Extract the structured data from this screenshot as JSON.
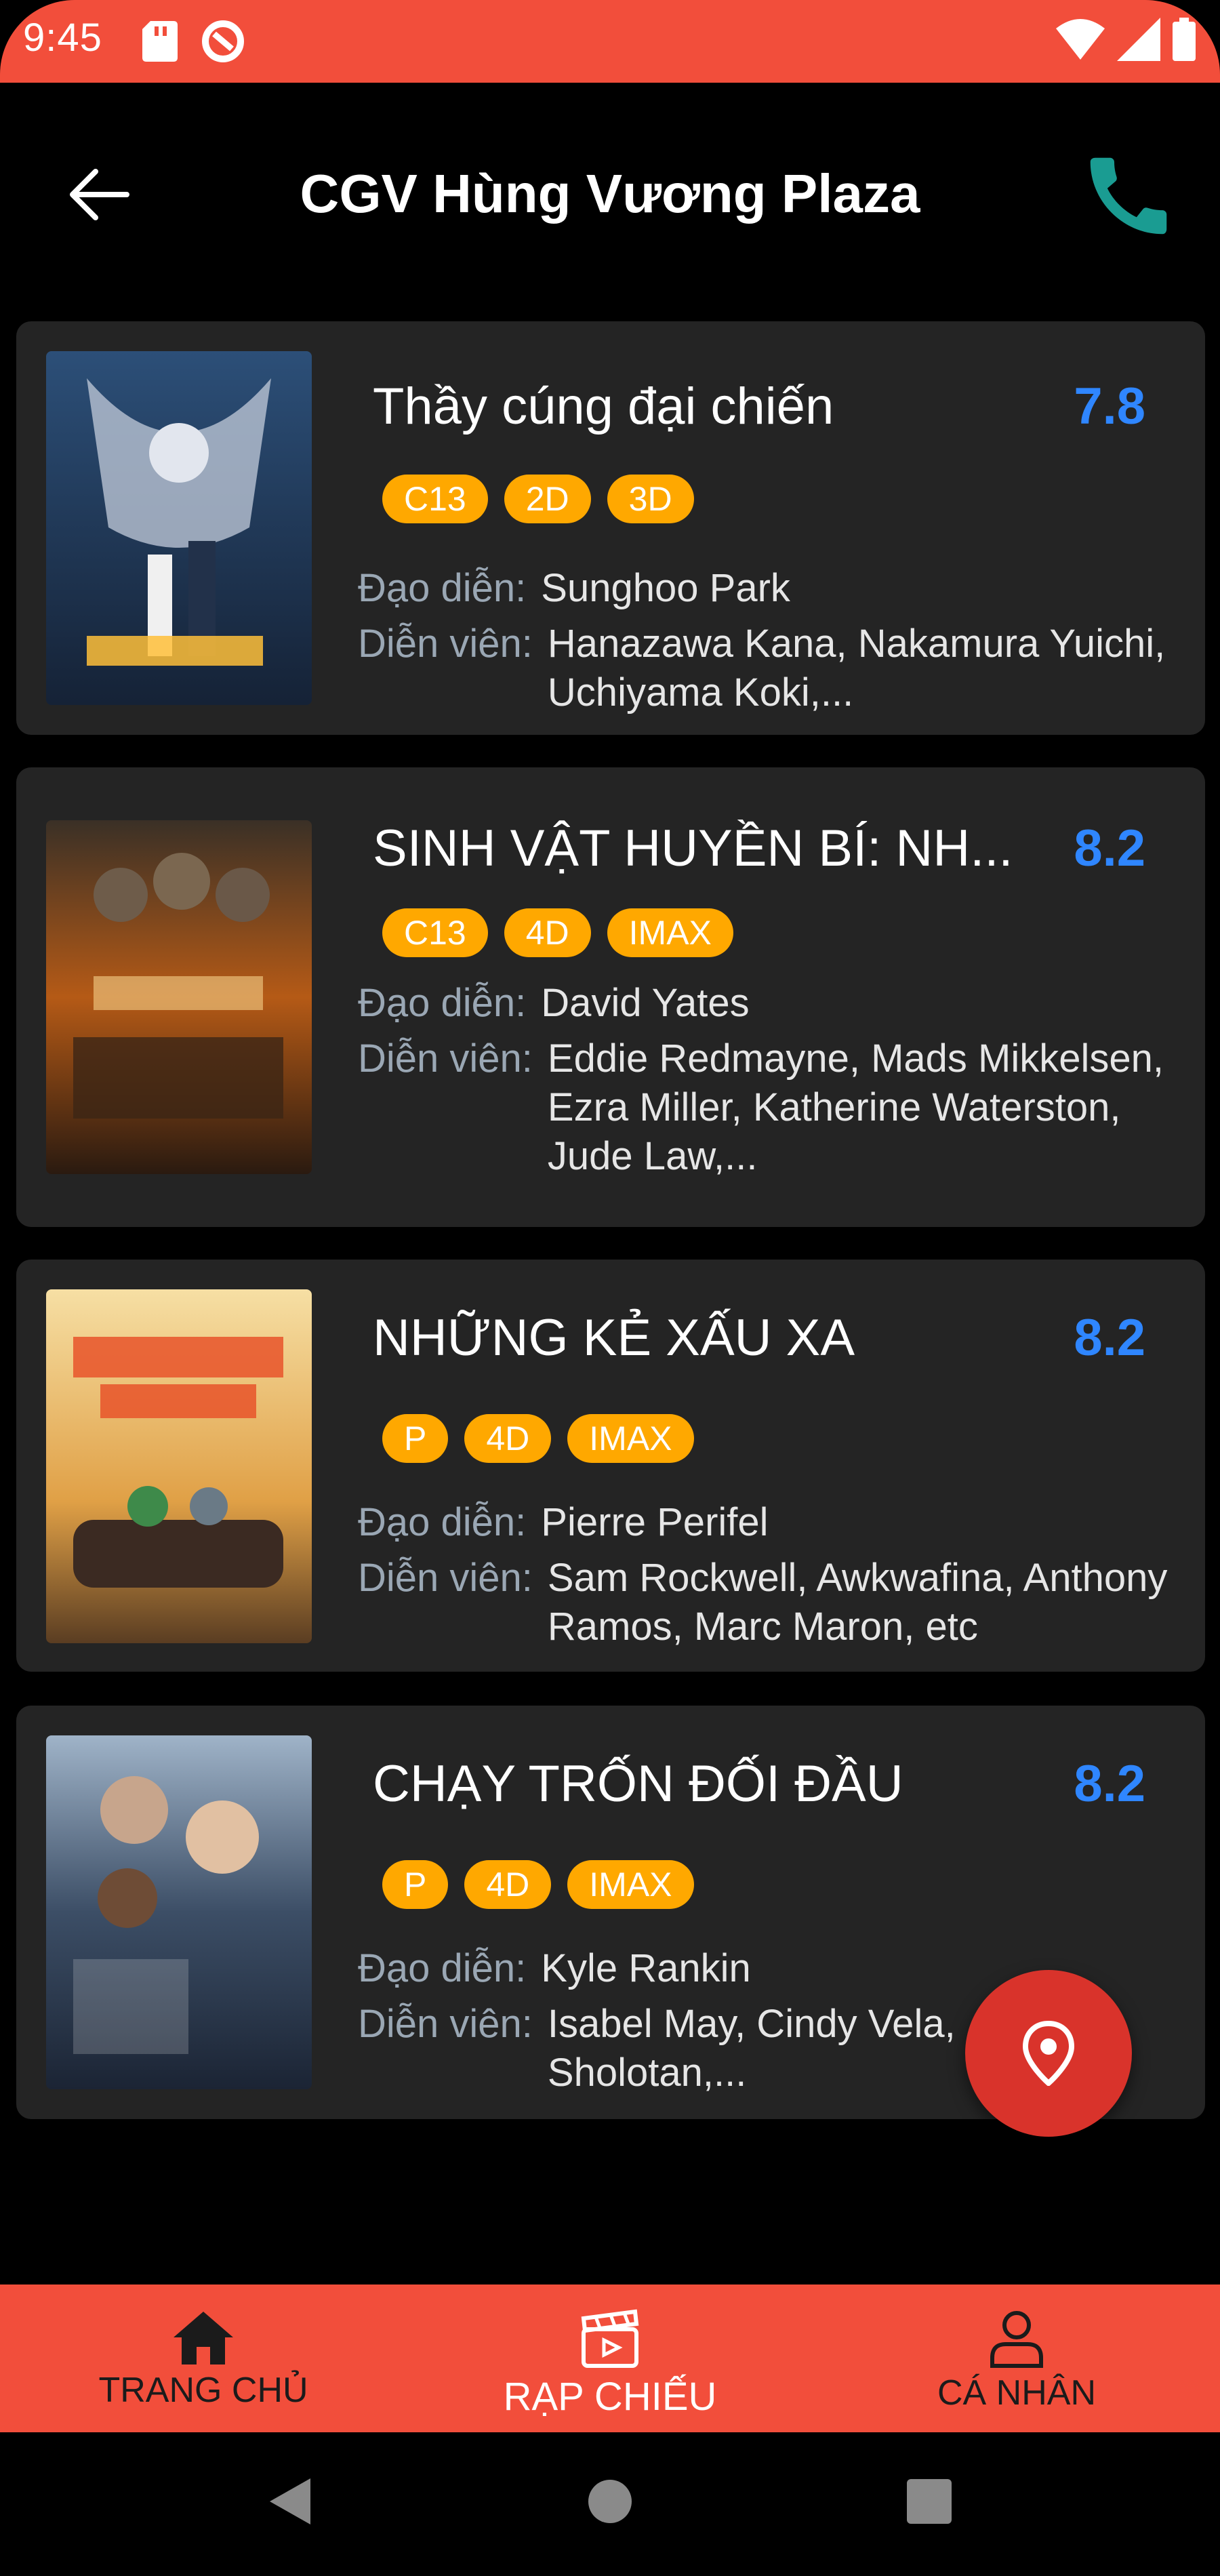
{
  "status_bar": {
    "time": "9:45"
  },
  "header": {
    "title": "CGV Hùng Vương Plaza"
  },
  "labels": {
    "director": "Đạo diễn:",
    "actors": "Diễn viên:"
  },
  "movies": [
    {
      "title": "Thầy cúng đại chiến",
      "rating": "7.8",
      "tags": [
        "C13",
        "2D",
        "3D"
      ],
      "director": "Sunghoo Park",
      "actors": "Hanazawa Kana, Nakamura Yuichi, Uchiyama Koki,...",
      "poster_color": "#1e3a5c"
    },
    {
      "title": "SINH VẬT HUYỀN BÍ: NH...",
      "rating": "8.2",
      "tags": [
        "C13",
        "4D",
        "IMAX"
      ],
      "director": "David Yates",
      "actors": "Eddie Redmayne, Mads Mikkelsen, Ezra Miller, Katherine Waterston, Jude Law,...",
      "poster_color": "#5a3214"
    },
    {
      "title": "NHỮNG KẺ XẤU XA",
      "rating": "8.2",
      "tags": [
        "P",
        "4D",
        "IMAX"
      ],
      "director": "Pierre Perifel",
      "actors": "Sam Rockwell, Awkwafina, Anthony Ramos, Marc Maron, etc",
      "poster_color": "#d89a3a"
    },
    {
      "title": "CHẠY TRỐN ĐỐI ĐẦU",
      "rating": "8.2",
      "tags": [
        "P",
        "4D",
        "IMAX"
      ],
      "director": "Kyle Rankin",
      "actors": "Isabel May, Cindy Vela, ...n, Olly Sholotan,...",
      "poster_color": "#2c3e55"
    }
  ],
  "bottom_nav": {
    "items": [
      {
        "label": "TRANG CHỦ",
        "icon": "home-icon"
      },
      {
        "label": "RẠP CHIẾU",
        "icon": "clapperboard-icon"
      },
      {
        "label": "CÁ NHÂN",
        "icon": "user-icon"
      }
    ],
    "active_index": 1
  },
  "colors": {
    "accent": "#f24e3b",
    "rating": "#2f86ff",
    "tag": "#ffa800",
    "card": "#242424",
    "fab": "#d9332b",
    "phone": "#1a9c92"
  }
}
